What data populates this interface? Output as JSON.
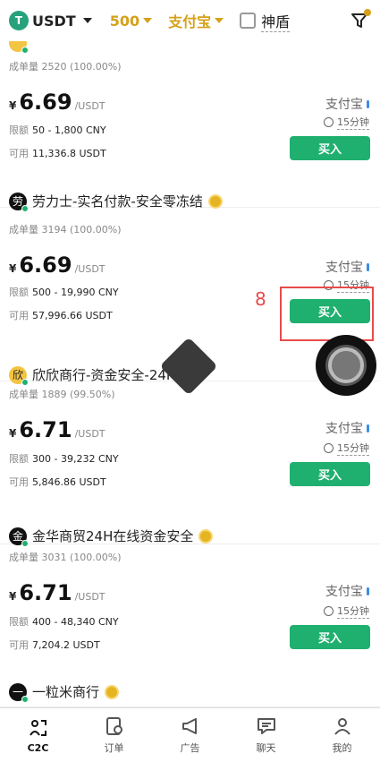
{
  "topbar": {
    "coin_logo": "T",
    "coin": "USDT",
    "amount": "500",
    "payment": "支付宝",
    "shield": "神盾"
  },
  "cards": [
    {
      "stats_label": "成单量",
      "stats": "2520 (100.00%)",
      "yen": "¥",
      "price": "6.69",
      "unit": "/USDT",
      "limit_label": "限额",
      "limit": "50 - 1,800 CNY",
      "avail_label": "可用",
      "avail": "11,336.8 USDT",
      "method": "支付宝",
      "time": "15分钟",
      "buy": "买入"
    },
    {
      "avatar": "劳",
      "merchant": "劳力士-实名付款-安全零冻结",
      "stats_label": "成单量",
      "stats": "3194 (100.00%)",
      "yen": "¥",
      "price": "6.69",
      "unit": "/USDT",
      "limit_label": "限额",
      "limit": "500 - 19,990 CNY",
      "avail_label": "可用",
      "avail": "57,996.66 USDT",
      "method": "支付宝",
      "time": "15分钟",
      "buy": "买入"
    },
    {
      "avatar": "欣",
      "merchant": "欣欣商行-资金安全-24H",
      "stats_label": "成单量",
      "stats": "1889 (99.50%)",
      "yen": "¥",
      "price": "6.71",
      "unit": "/USDT",
      "limit_label": "限额",
      "limit": "300 - 39,232 CNY",
      "avail_label": "可用",
      "avail": "5,846.86 USDT",
      "method": "支付宝",
      "time": "15分钟",
      "buy": "买入"
    },
    {
      "avatar": "金",
      "merchant": "金华商贸24H在线资金安全",
      "stats_label": "成单量",
      "stats": "3031 (100.00%)",
      "yen": "¥",
      "price": "6.71",
      "unit": "/USDT",
      "limit_label": "限额",
      "limit": "400 - 48,340 CNY",
      "avail_label": "可用",
      "avail": "7,204.2 USDT",
      "method": "支付宝",
      "time": "15分钟",
      "buy": "买入"
    },
    {
      "avatar": "一",
      "merchant": "一粒米商行"
    }
  ],
  "annotation": "8",
  "nav": [
    {
      "label": "C2C"
    },
    {
      "label": "订单"
    },
    {
      "label": "广告"
    },
    {
      "label": "聊天"
    },
    {
      "label": "我的"
    }
  ]
}
